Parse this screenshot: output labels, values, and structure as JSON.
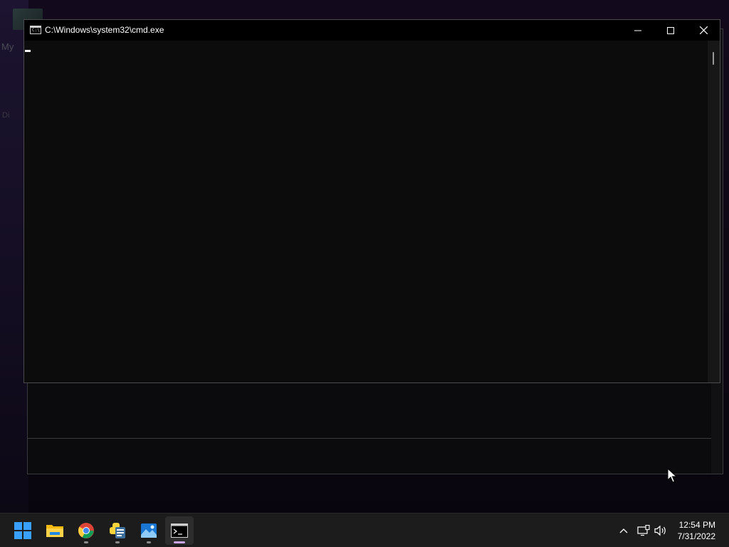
{
  "desktop": {
    "icon_label": "My",
    "icon_label2": "Di"
  },
  "cmd_window": {
    "title": "C:\\Windows\\system32\\cmd.exe",
    "icon_text": "C:\\",
    "console_text": ""
  },
  "taskbar": {
    "items": [
      {
        "name": "Start",
        "icon": "windows-start-icon",
        "running": false,
        "active": false
      },
      {
        "name": "File Explorer",
        "icon": "folder-icon",
        "running": false,
        "active": false
      },
      {
        "name": "Google Chrome",
        "icon": "chrome-icon",
        "running": true,
        "active": false
      },
      {
        "name": "Python",
        "icon": "python-icon",
        "running": true,
        "active": false
      },
      {
        "name": "Photos",
        "icon": "photos-icon",
        "running": true,
        "active": false
      },
      {
        "name": "Command Prompt",
        "icon": "cmd-icon",
        "running": true,
        "active": true
      }
    ],
    "tray": {
      "time": "12:54 PM",
      "date": "7/31/2022"
    }
  },
  "colors": {
    "console_bg": "#0c0c0c",
    "titlebar_bg": "#000000",
    "taskbar_bg": "#1c1c1c",
    "active_indicator": "#c9a4e6"
  }
}
